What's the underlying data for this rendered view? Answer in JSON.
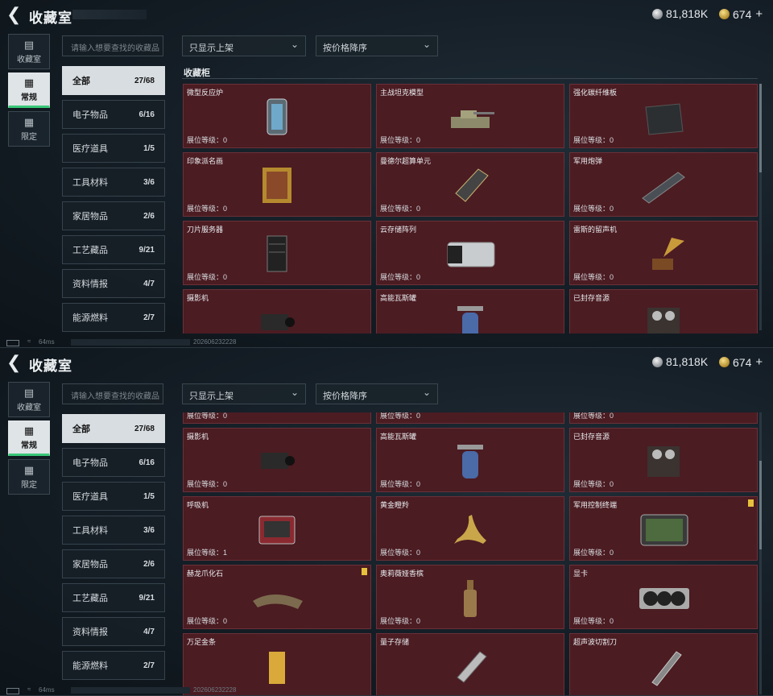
{
  "header": {
    "title": "收藏室",
    "currency_silver": "81,818K",
    "currency_gold": "674",
    "plus": "+"
  },
  "left_nav": [
    {
      "label": "收藏室",
      "icon": "display-case-icon"
    },
    {
      "label": "常规",
      "icon": "picture-icon",
      "active": true
    },
    {
      "label": "限定",
      "icon": "picture-icon"
    }
  ],
  "search": {
    "placeholder": "请输入想要查找的收藏品"
  },
  "filters": {
    "shelf_filter": "只显示上架",
    "sort": "按价格降序"
  },
  "categories": [
    {
      "label": "全部",
      "count": "27/68",
      "active": true
    },
    {
      "label": "电子物品",
      "count": "6/16"
    },
    {
      "label": "医疗道具",
      "count": "1/5"
    },
    {
      "label": "工具材料",
      "count": "3/6"
    },
    {
      "label": "家居物品",
      "count": "2/6"
    },
    {
      "label": "工艺藏品",
      "count": "9/21"
    },
    {
      "label": "资料情报",
      "count": "4/7"
    },
    {
      "label": "能源燃料",
      "count": "2/7"
    }
  ],
  "section_title": "收藏柜",
  "panel1_items": [
    {
      "name": "微型反应炉",
      "level": "展位等级：0",
      "icon": "reactor-icon"
    },
    {
      "name": "主战坦克模型",
      "level": "展位等级：0",
      "icon": "tank-icon"
    },
    {
      "name": "强化碳纤维板",
      "level": "展位等级：0",
      "icon": "carbon-plate-icon"
    },
    {
      "name": "印象派名画",
      "level": "展位等级：0",
      "icon": "painting-icon"
    },
    {
      "name": "曼德尔超算单元",
      "level": "展位等级：0",
      "icon": "compute-unit-icon"
    },
    {
      "name": "军用炮弹",
      "level": "展位等级：0",
      "icon": "shell-icon"
    },
    {
      "name": "刀片服务器",
      "level": "展位等级：0",
      "icon": "server-icon"
    },
    {
      "name": "云存储阵列",
      "level": "展位等级：0",
      "icon": "storage-array-icon"
    },
    {
      "name": "雷斯的留声机",
      "level": "展位等级：0",
      "icon": "gramophone-icon"
    },
    {
      "name": "摄影机",
      "level": "",
      "icon": "camera-icon"
    },
    {
      "name": "高能瓦斯罐",
      "level": "",
      "icon": "gas-canister-icon"
    },
    {
      "name": "已封存音源",
      "level": "",
      "icon": "tape-recorder-icon"
    }
  ],
  "panel2_items": [
    {
      "name": "",
      "level": "展位等级：0",
      "icon": "item-icon"
    },
    {
      "name": "",
      "level": "展位等级：0",
      "icon": "item-icon"
    },
    {
      "name": "",
      "level": "展位等级：0",
      "icon": "item-icon"
    },
    {
      "name": "摄影机",
      "level": "展位等级：0",
      "icon": "camera-icon"
    },
    {
      "name": "高能瓦斯罐",
      "level": "展位等级：0",
      "icon": "gas-canister-icon"
    },
    {
      "name": "已封存音源",
      "level": "展位等级：0",
      "icon": "tape-recorder-icon"
    },
    {
      "name": "呼吸机",
      "level": "展位等级：1",
      "icon": "ventilator-icon"
    },
    {
      "name": "黄金瞪羚",
      "level": "展位等级：0",
      "icon": "gazelle-icon"
    },
    {
      "name": "军用控制终端",
      "level": "展位等级：0",
      "icon": "terminal-icon",
      "flag": true
    },
    {
      "name": "赫龙爪化石",
      "level": "展位等级：0",
      "icon": "claw-fossil-icon",
      "flag": true
    },
    {
      "name": "奥莉薇娅香槟",
      "level": "展位等级：0",
      "icon": "champagne-icon"
    },
    {
      "name": "显卡",
      "level": "展位等级：0",
      "icon": "gpu-icon"
    },
    {
      "name": "万足金条",
      "level": "",
      "icon": "gold-bar-icon"
    },
    {
      "name": "量子存储",
      "level": "",
      "icon": "quantum-storage-icon"
    },
    {
      "name": "超声波切割刀",
      "level": "",
      "icon": "ultrasonic-cutter-icon"
    }
  ],
  "status": {
    "ping": "64ms",
    "uid": "202606232228"
  },
  "colors": {
    "card_bg": "#4b1c22",
    "active_accent": "#39c779",
    "flag": "#e7c13c"
  }
}
